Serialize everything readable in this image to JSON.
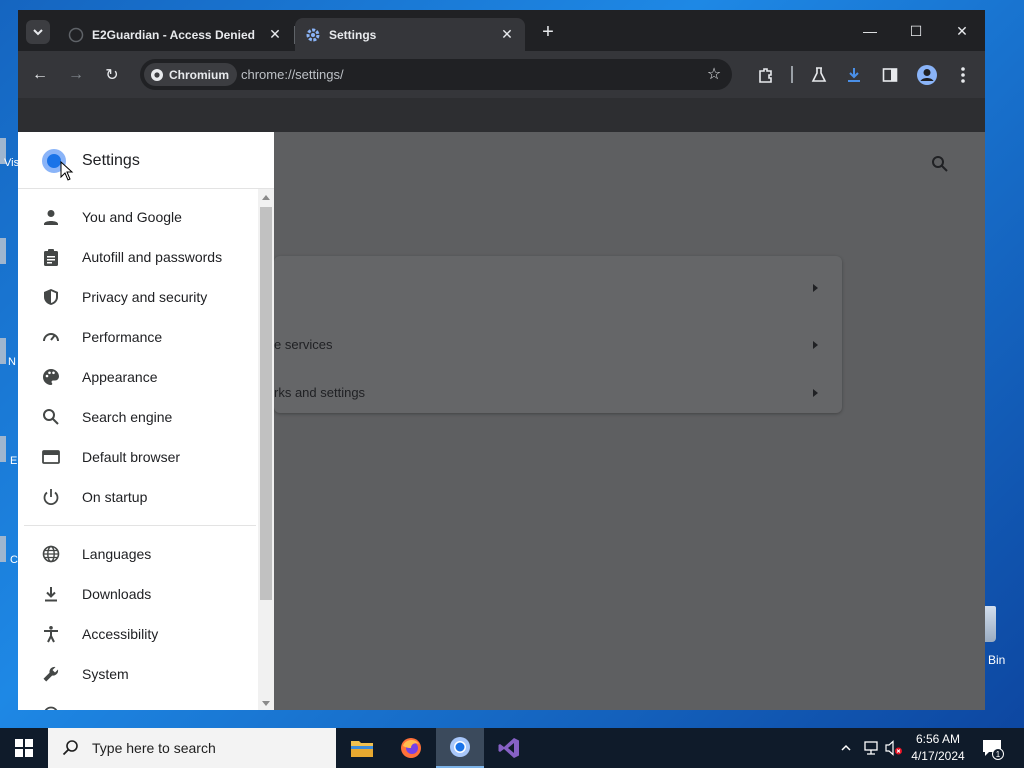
{
  "desktop": {
    "fragments": [
      "Vis",
      "N",
      "E",
      "C"
    ],
    "recycle_bin_label": "Bin"
  },
  "browser": {
    "tabs": [
      {
        "title": "E2Guardian - Access Denied",
        "active": false,
        "close": "✕"
      },
      {
        "title": "Settings",
        "active": true,
        "close": "✕"
      }
    ],
    "new_tab": "+",
    "window_controls": {
      "minimize": "—",
      "maximize": "☐",
      "close": "✕"
    },
    "toolbar": {
      "chip_label": "Chromium",
      "url": "chrome://settings/",
      "back": "←",
      "forward": "→",
      "reload": "↻",
      "star": "☆"
    }
  },
  "settings": {
    "title": "Settings",
    "nav_items": [
      {
        "label": "You and Google",
        "icon": "person-icon"
      },
      {
        "label": "Autofill and passwords",
        "icon": "clipboard-icon"
      },
      {
        "label": "Privacy and security",
        "icon": "shield-icon"
      },
      {
        "label": "Performance",
        "icon": "gauge-icon"
      },
      {
        "label": "Appearance",
        "icon": "palette-icon"
      },
      {
        "label": "Search engine",
        "icon": "search-icon"
      },
      {
        "label": "Default browser",
        "icon": "browser-window-icon"
      },
      {
        "label": "On startup",
        "icon": "power-icon"
      },
      {
        "label": "Languages",
        "icon": "globe-icon"
      },
      {
        "label": "Downloads",
        "icon": "download-icon"
      },
      {
        "label": "Accessibility",
        "icon": "accessibility-icon"
      },
      {
        "label": "System",
        "icon": "wrench-icon"
      }
    ],
    "card_rows": [
      "",
      "e services",
      "rks and settings"
    ]
  },
  "taskbar": {
    "search_placeholder": "Type here to search",
    "time": "6:56 AM",
    "date": "4/17/2024",
    "notification_count": "1"
  }
}
